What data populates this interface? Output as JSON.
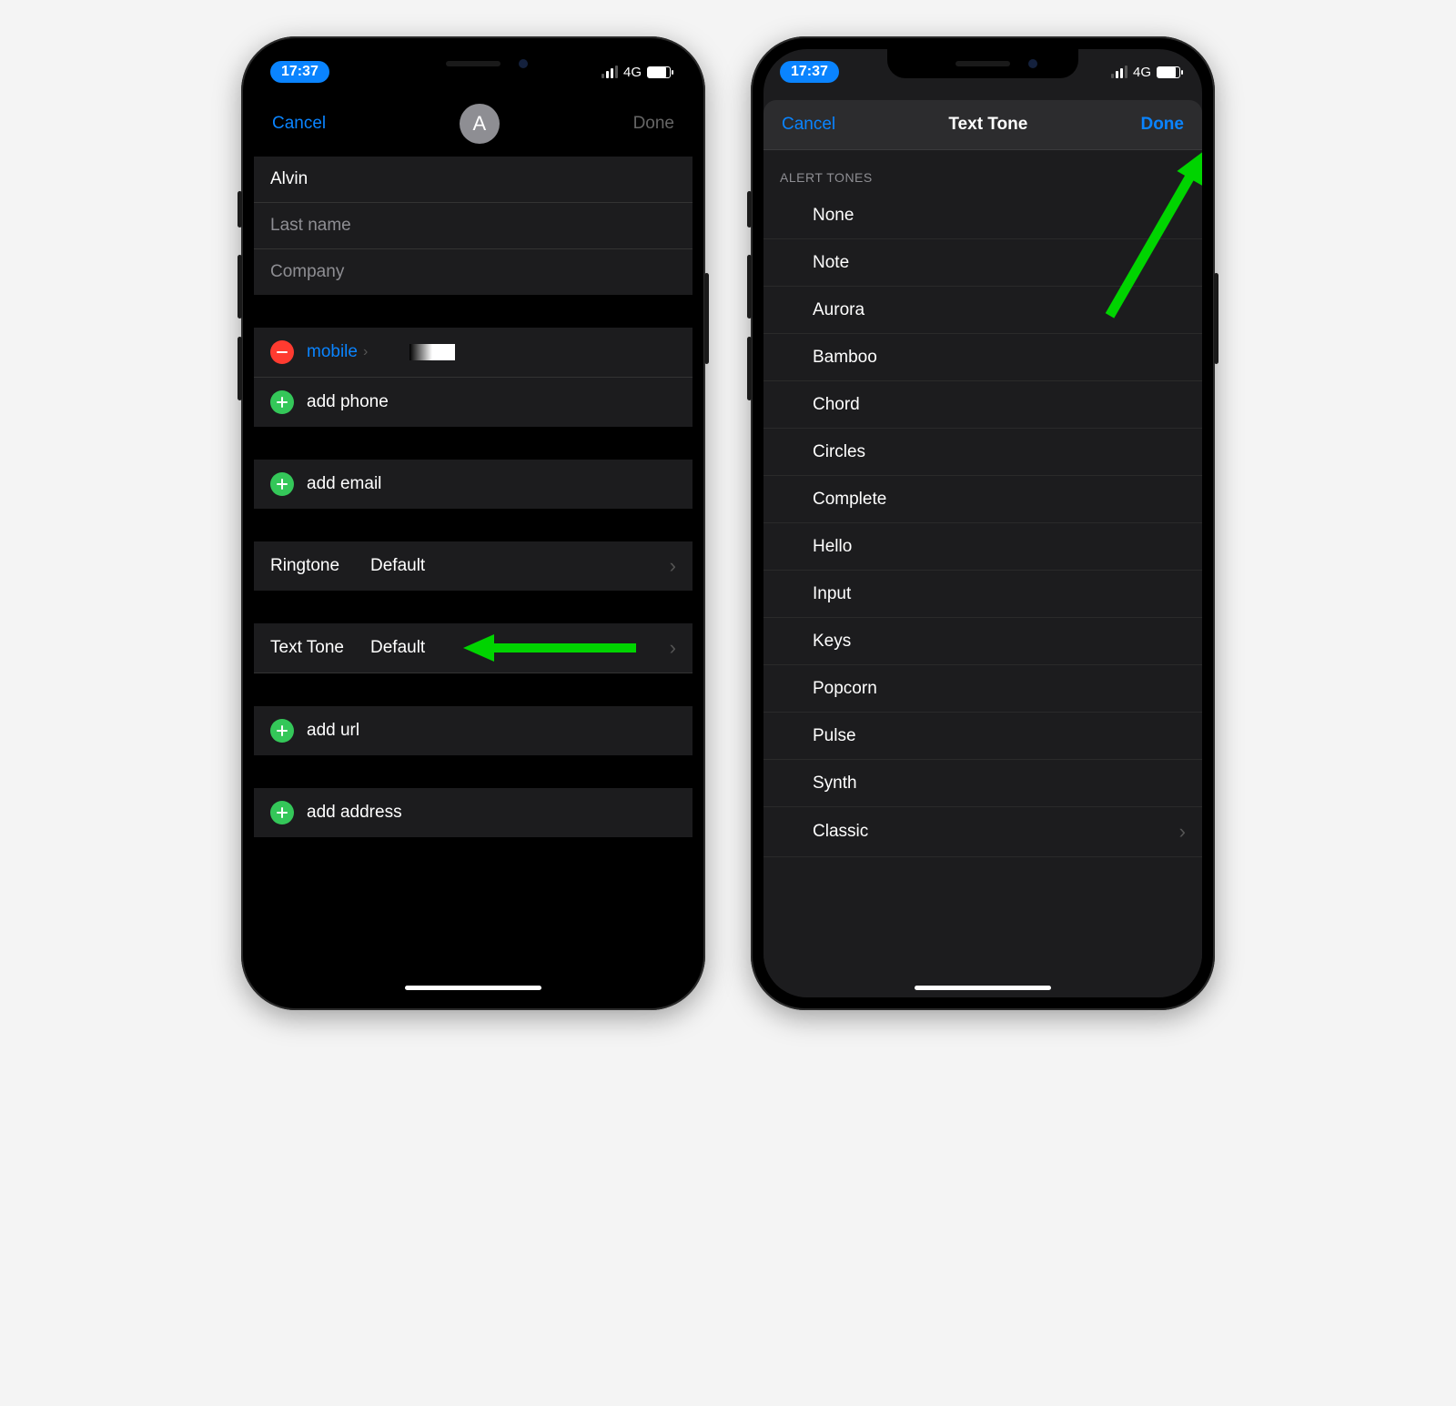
{
  "status": {
    "time": "17:37",
    "network": "4G"
  },
  "leftScreen": {
    "nav": {
      "cancel": "Cancel",
      "done": "Done",
      "avatarInitial": "A"
    },
    "firstName": "Alvin",
    "lastNamePlaceholder": "Last name",
    "companyPlaceholder": "Company",
    "phoneLabel": "mobile",
    "addPhone": "add phone",
    "addEmail": "add email",
    "ringtoneLabel": "Ringtone",
    "ringtoneValue": "Default",
    "textToneLabel": "Text Tone",
    "textToneValue": "Default",
    "addUrl": "add url",
    "addAddress": "add address"
  },
  "rightScreen": {
    "nav": {
      "cancel": "Cancel",
      "title": "Text Tone",
      "done": "Done"
    },
    "sectionHeader": "ALERT TONES",
    "tones": [
      "None",
      "Note",
      "Aurora",
      "Bamboo",
      "Chord",
      "Circles",
      "Complete",
      "Hello",
      "Input",
      "Keys",
      "Popcorn",
      "Pulse",
      "Synth",
      "Classic"
    ]
  }
}
